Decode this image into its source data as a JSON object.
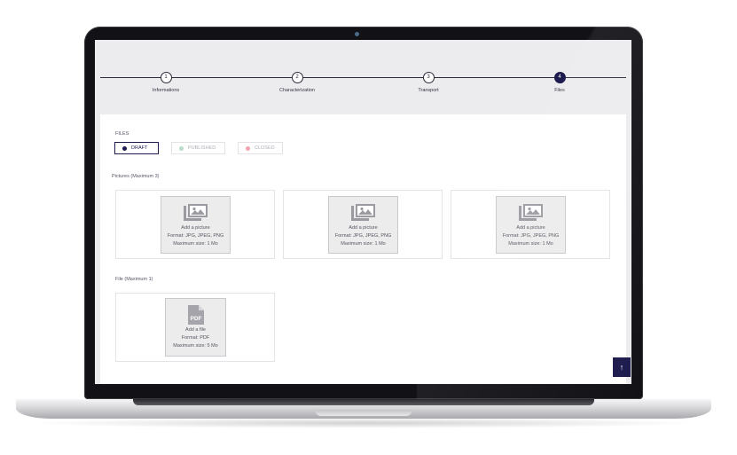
{
  "stepper": {
    "steps": [
      {
        "number": "1",
        "label": "Informations"
      },
      {
        "number": "2",
        "label": "Characterization"
      },
      {
        "number": "3",
        "label": "Transport"
      },
      {
        "number": "4",
        "label": "Files"
      }
    ],
    "active_step": 4
  },
  "files": {
    "title": "FILES",
    "statuses": [
      {
        "label": "DRAFT",
        "color": "#1d1a4d",
        "selected": true
      },
      {
        "label": "PUBLISHED",
        "color": "#b9dcc8",
        "selected": false
      },
      {
        "label": "CLOSED",
        "color": "#f2a3ae",
        "selected": false
      }
    ]
  },
  "pictures": {
    "title": "Pictures (Maximum 3)",
    "slots": [
      {
        "line1": "Add a picture",
        "line2": "Format: JPG, JPEG, PNG",
        "line3": "Maximum size: 1 Mo"
      },
      {
        "line1": "Add a picture",
        "line2": "Format: JPG, JPEG, PNG",
        "line3": "Maximum size: 1 Mo"
      },
      {
        "line1": "Add a picture",
        "line2": "Format: JPG, JPEG, PNG",
        "line3": "Maximum size: 1 Mo"
      }
    ]
  },
  "file_section": {
    "title": "File (Maximum 1)",
    "slot": {
      "icon_text": "PDF",
      "line1": "Add a file",
      "line2": "Format: PDF",
      "line3": "Maximum size: 5 Mo"
    }
  },
  "scroll_top": {
    "icon": "arrow-up-icon",
    "glyph": "↑"
  },
  "colors": {
    "primary": "#1d1a4d",
    "screen_bg": "#ececee"
  }
}
